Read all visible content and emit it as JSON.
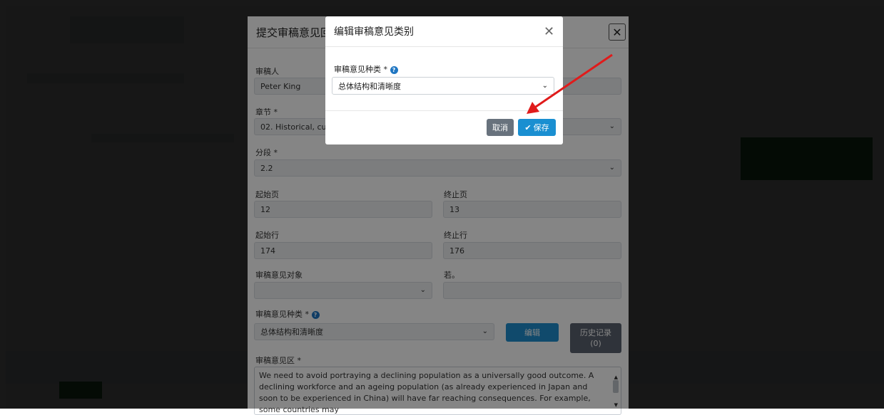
{
  "edit_dialog": {
    "title": "编辑审稿意见类别",
    "field_label": "审稿意见种类 *",
    "selected": "总体结构和清晰度",
    "cancel": "取消",
    "save": "保存"
  },
  "submit_dialog": {
    "title": "提交审稿意见回",
    "reviewer_label": "审稿人",
    "reviewer_value": "Peter King",
    "chapter_label": "章节 *",
    "chapter_value": "02. Historical, cur",
    "section_label": "分段 *",
    "section_value": "2.2",
    "start_page_label": "起始页",
    "start_page_value": "12",
    "end_page_label": "终止页",
    "end_page_value": "13",
    "start_line_label": "起始行",
    "start_line_value": "174",
    "end_line_label": "终止行",
    "end_line_value": "176",
    "target_label": "审稿意见对象",
    "other_label": "若。",
    "type_label": "审稿意见种类 *",
    "type_value": "总体结构和清晰度",
    "edit_button": "编辑",
    "history_button": "历史记录",
    "history_count": "(0)",
    "comment_label": "审稿意见区 *",
    "comment_text": "We need to avoid portraying a declining population as a universally good outcome.  A declining workforce and an ageing population (as already experienced in Japan and soon to be experienced in China) will have far reaching consequences. For example, some countries may"
  },
  "colors": {
    "primary": "#1a8fd1",
    "secondary": "#68727d",
    "arrow": "#e01b1b"
  }
}
